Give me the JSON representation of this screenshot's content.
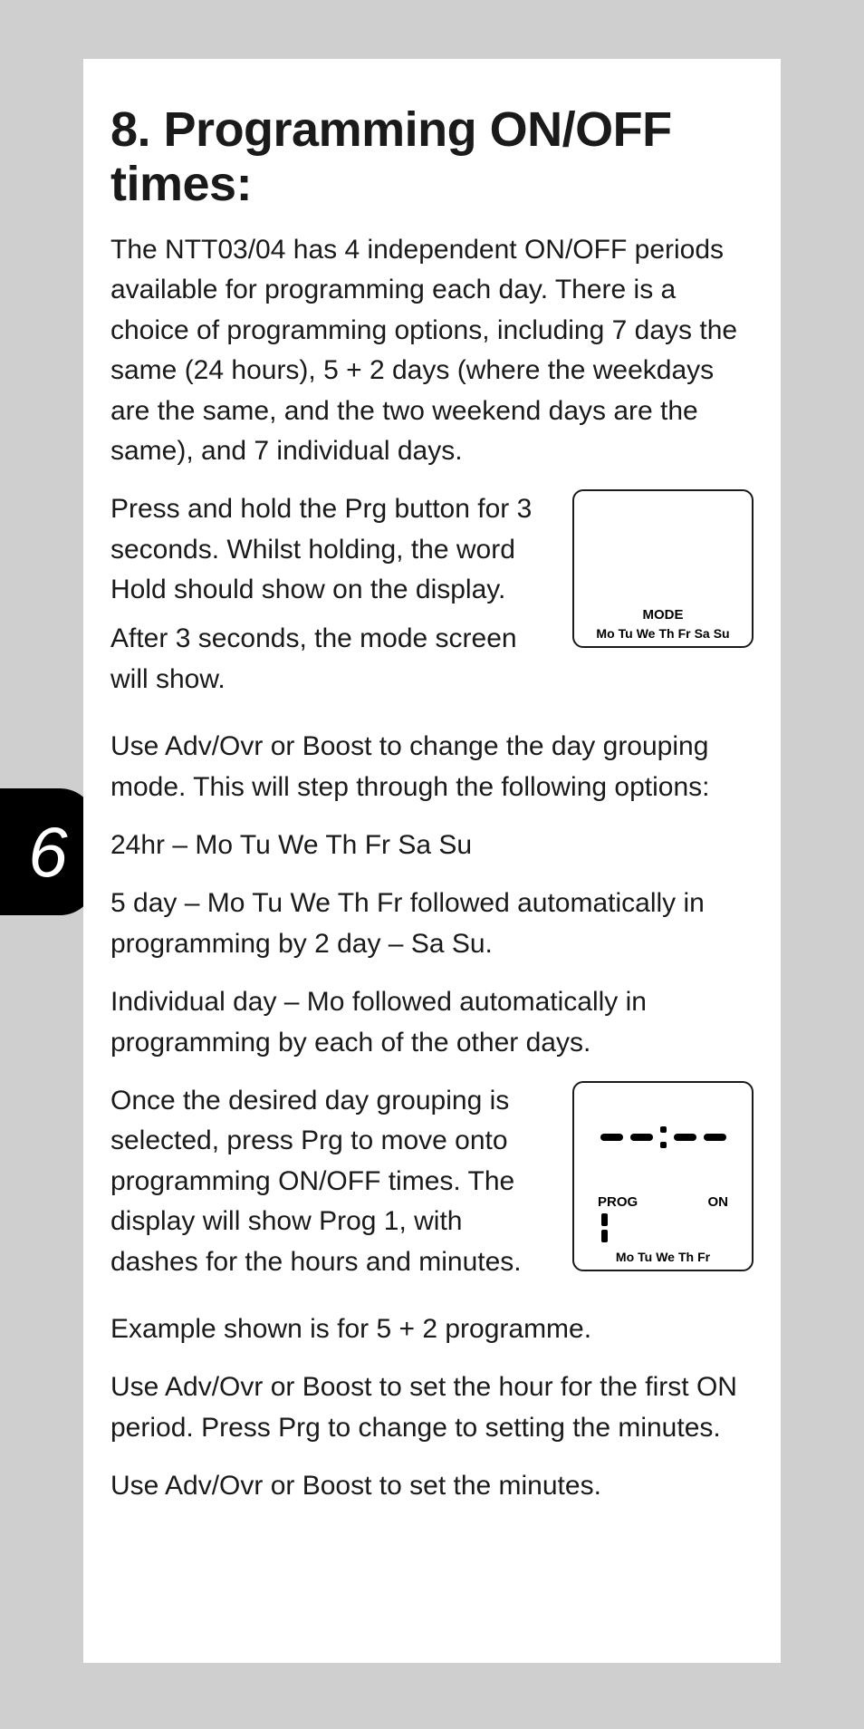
{
  "page_number": "6",
  "heading": "8. Programming ON/OFF times:",
  "p1": "The NTT03/04 has 4 independent ON/OFF periods available for programming each day. There is a choice of programming options, including 7 days the same (24 hours), 5 + 2 days (where the weekdays are the same, and the two weekend days are the same), and 7 individual days.",
  "p2a": "Press and hold the Prg button for 3 seconds. Whilst holding, the word Hold should show on the display.",
  "p2b": "After 3 seconds, the mode screen will show.",
  "p3": "Use Adv/Ovr or Boost to change the day grouping mode. This will step through the following options:",
  "p4": "24hr – Mo Tu We Th Fr Sa Su",
  "p5": "5 day – Mo Tu We Th Fr followed automatically in programming by 2 day – Sa Su.",
  "p6": "Individual day – Mo followed automatically in programming by each of the other days.",
  "p7": "Once the desired day grouping is selected, press Prg to move onto programming ON/OFF times. The display will show Prog 1, with dashes for the hours and minutes.",
  "p8": "Example shown is for 5 + 2 programme.",
  "p9": "Use Adv/Ovr or Boost to set the hour for the first ON period. Press Prg to change to setting the minutes.",
  "p10": "Use Adv/Ovr or Boost to set the minutes.",
  "lcd1": {
    "mode_label": "MODE",
    "days": [
      "Mo",
      "Tu",
      "We",
      "Th",
      "Fr",
      "Sa",
      "Su"
    ]
  },
  "lcd2": {
    "prog_label": "PROG",
    "on_label": "ON",
    "days": [
      "Mo",
      "Tu",
      "We",
      "Th",
      "Fr"
    ]
  }
}
